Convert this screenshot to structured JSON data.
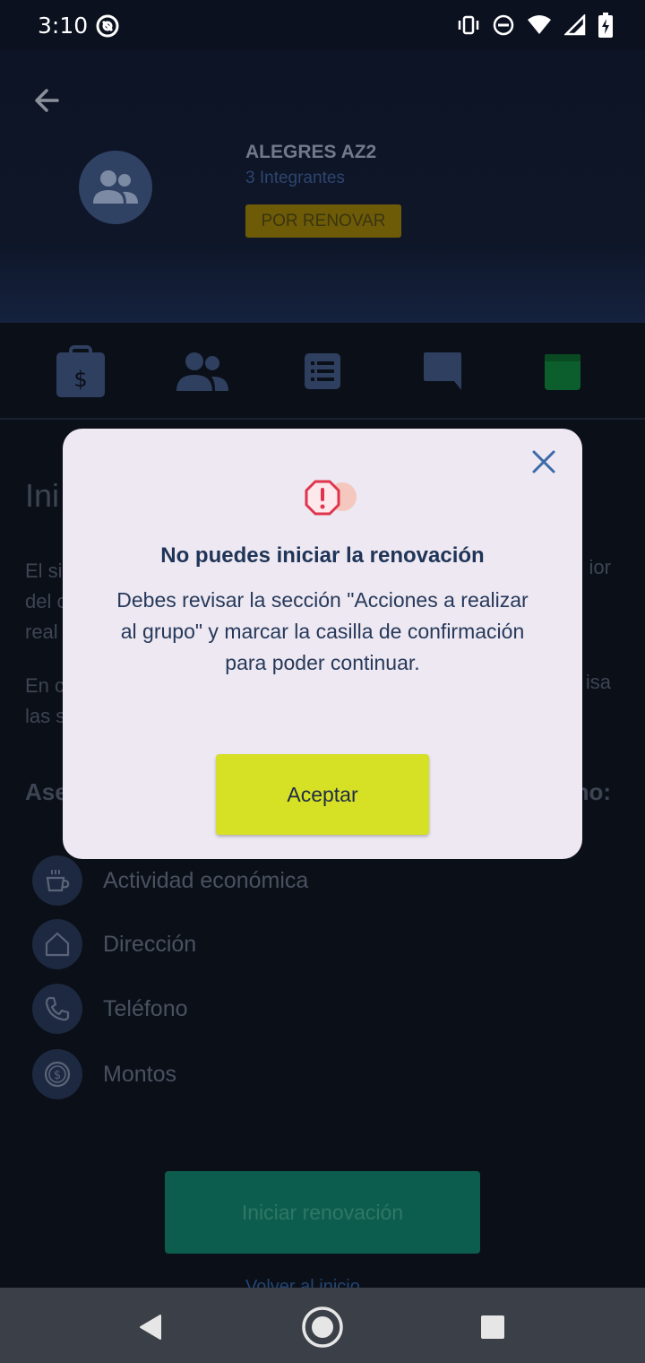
{
  "status_bar": {
    "time": "3:10",
    "icons": [
      "at-sign-icon",
      "vibrate-icon",
      "do-not-disturb-icon",
      "wifi-icon",
      "signal-icon",
      "battery-charging-icon"
    ]
  },
  "header": {
    "group_name": "ALEGRES AZ2",
    "members": "3 Integrantes",
    "badge": "POR RENOVAR",
    "badge_color": "#6d5b08"
  },
  "tabs": [
    {
      "icon": "clipboard-dollar-icon"
    },
    {
      "icon": "group-icon"
    },
    {
      "icon": "list-icon"
    },
    {
      "icon": "chat-icon"
    },
    {
      "icon": "calendar-icon",
      "active": true
    }
  ],
  "content": {
    "title_partial": "Ini",
    "line1_partial": "El si",
    "line1_right": "ior",
    "line2_partial": "del c",
    "line3_partial": "real",
    "line4_partial": "En c",
    "line4_right": "isa",
    "line5_partial": "las s",
    "assess_partial": "Ase",
    "assess_right": "no:",
    "items": [
      {
        "label": "Actividad económica",
        "icon": "coffee-icon"
      },
      {
        "label": "Dirección",
        "icon": "home-icon"
      },
      {
        "label": "Teléfono",
        "icon": "phone-icon"
      },
      {
        "label": "Montos",
        "icon": "coin-icon"
      }
    ],
    "start_button": "Iniciar renovación",
    "back_home": "Volver al inicio"
  },
  "dialog": {
    "title": "No puedes iniciar la renovación",
    "message": "Debes revisar la sección \"Acciones a realizar al grupo\" y marcar la casilla de confirmación para poder continuar.",
    "accept": "Aceptar",
    "accent": "#d6e024"
  },
  "navbar": {
    "icons": [
      "back-triangle-icon",
      "home-circle-icon",
      "recents-square-icon"
    ]
  }
}
